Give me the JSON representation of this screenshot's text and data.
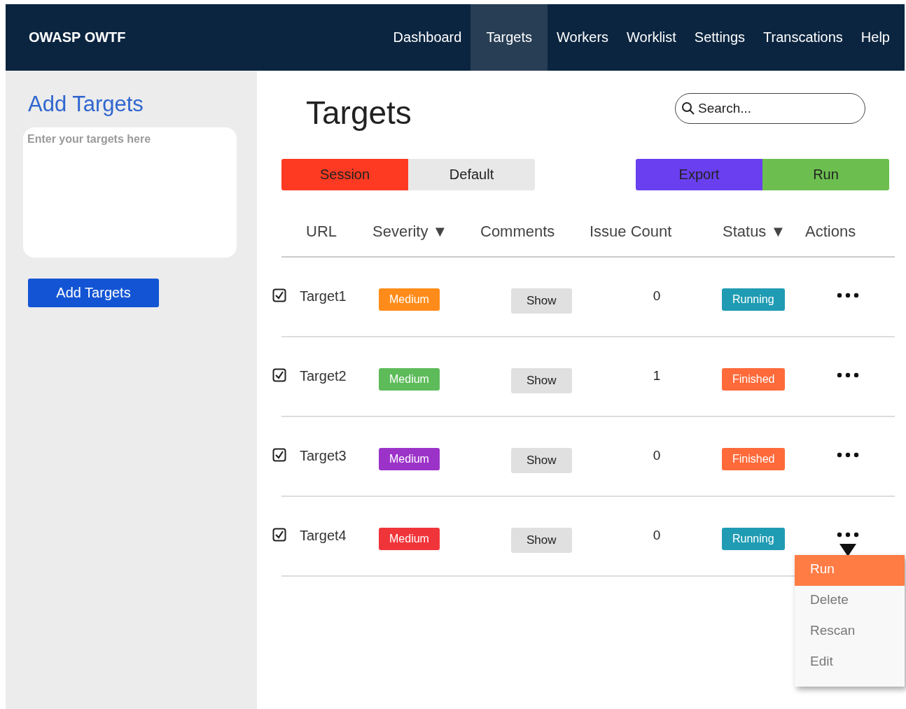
{
  "navbar": {
    "brand": "OWASP OWTF",
    "links": [
      {
        "label": "Dashboard",
        "selected": false
      },
      {
        "label": "Targets",
        "selected": true
      },
      {
        "label": "Workers",
        "selected": false
      },
      {
        "label": "Worklist",
        "selected": false
      },
      {
        "label": "Settings",
        "selected": false
      },
      {
        "label": "Transcations",
        "selected": false
      },
      {
        "label": "Help",
        "selected": false
      }
    ]
  },
  "sidebar": {
    "title": "Add Targets",
    "textarea": {
      "placeholder": "Enter your targets here"
    },
    "button": "Add Targets"
  },
  "main": {
    "title": "Targets",
    "search": {
      "placeholder": "Search..."
    },
    "toggle": [
      {
        "label": "Session",
        "selected": true
      },
      {
        "label": "Default",
        "selected": false
      }
    ],
    "actions": [
      {
        "label": "Export",
        "color": "#6a3ff0"
      },
      {
        "label": "Run",
        "color": "#6cbf4f"
      }
    ],
    "table": {
      "columns": [
        "URL",
        "Severity ▼",
        "Comments",
        "Issue Count",
        "Status ▼",
        "Actions"
      ],
      "rows": [
        {
          "checked": true,
          "url": "Target1",
          "severity": {
            "label": "Medium",
            "color": "#ff8c1a"
          },
          "comments": "Show",
          "issue_count": "0",
          "status": {
            "label": "Running",
            "color": "#1f9cb3"
          }
        },
        {
          "checked": true,
          "url": "Target2",
          "severity": {
            "label": "Medium",
            "color": "#5dbb5a"
          },
          "comments": "Show",
          "issue_count": "1",
          "status": {
            "label": "Finished",
            "color": "#ff6a3a"
          }
        },
        {
          "checked": true,
          "url": "Target3",
          "severity": {
            "label": "Medium",
            "color": "#9c33c9"
          },
          "comments": "Show",
          "issue_count": "0",
          "status": {
            "label": "Finished",
            "color": "#ff6a3a"
          }
        },
        {
          "checked": true,
          "url": "Target4",
          "severity": {
            "label": "Medium",
            "color": "#f0353a"
          },
          "comments": "Show",
          "issue_count": "0",
          "status": {
            "label": "Running",
            "color": "#1f9cb3"
          },
          "menu": [
            {
              "label": "Run",
              "selected": true
            },
            {
              "label": "Delete",
              "selected": false
            },
            {
              "label": "Rescan",
              "selected": false
            },
            {
              "label": "Edit",
              "selected": false
            }
          ]
        }
      ]
    }
  }
}
